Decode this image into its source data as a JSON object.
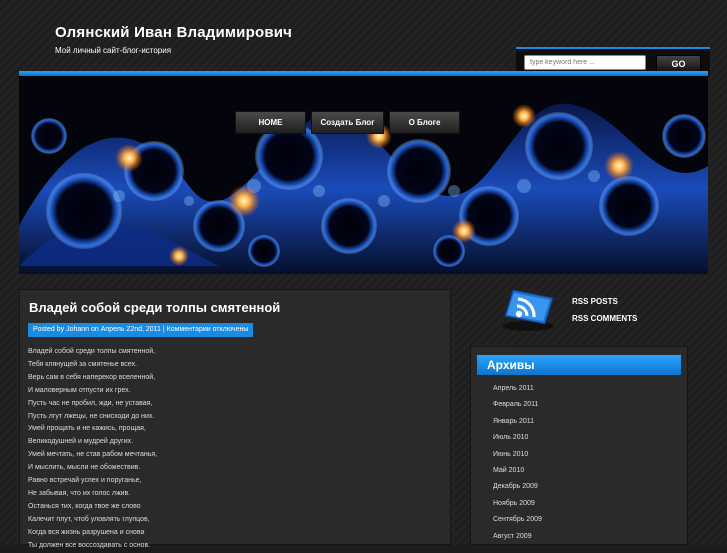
{
  "header": {
    "title": "Олянский Иван Владимирович",
    "description": "Мой личный сайт-блог-история"
  },
  "search": {
    "placeholder": "type keyword here ...",
    "button_label": "GO"
  },
  "nav": {
    "items": [
      {
        "label": "HOME"
      },
      {
        "label": "Создать Блог"
      },
      {
        "label": "О Блоге"
      }
    ]
  },
  "post": {
    "title": "Владей собой среди толпы смятенной",
    "meta": "Posted by Johann on Апрель 22nd, 2011 | Комментарии отключены",
    "lines": [
      "Владей собой среди толпы смятенной,",
      "Тебя клянущей за смятенье всех.",
      "Верь сам в себя наперекор вселенной,",
      "И маловерным отпусти их грех.",
      "Пусть час не пробил, жди, не уставая,",
      "Пусть лгут лжецы, не снисходи до них.",
      "Умей прощать и не кажись, прощая,",
      "Великодушней и мудрей других.",
      "Умей мечтать, не став рабом мечтанья,",
      "И мыслить, мысли не обожествив.",
      "Равно встречай успех и поруганье,",
      "Не забывая, что их голос лжив.",
      "Останься тих, когда твое же слово",
      "Калечит плут, чтоб уловлять глупцов,",
      "Когда вся жизнь разрушена и снова",
      "Ты должен все воссоздавать с основ."
    ]
  },
  "rss": {
    "icon": "rss-icon",
    "posts_label": "RSS POSTS",
    "comments_label": "RSS COMMENTS"
  },
  "archives": {
    "title": "Архивы",
    "items": [
      "Апрель 2011",
      "Февраль 2011",
      "Январь 2011",
      "Июль 2010",
      "Июнь 2010",
      "Май 2010",
      "Декабрь 2009",
      "Ноябрь 2009",
      "Сентябрь 2009",
      "Август 2009"
    ]
  },
  "colors": {
    "accent": "#1a8be0",
    "background": "#1c1c1c",
    "panel": "#2a2a2a"
  }
}
